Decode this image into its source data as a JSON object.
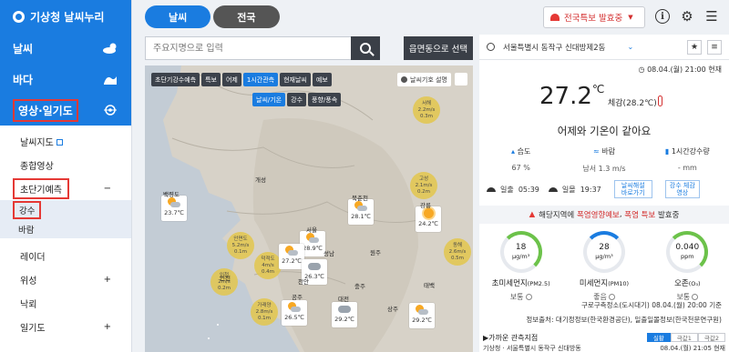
{
  "app": {
    "title": "기상청 날씨누리"
  },
  "sidebar": {
    "categories": [
      {
        "label": "날씨"
      },
      {
        "label": "바다"
      },
      {
        "label": "영상·일기도"
      }
    ],
    "sub_items": [
      {
        "label": "날씨지도"
      },
      {
        "label": "종합영상"
      },
      {
        "label": "초단기예측",
        "toggle": "−"
      },
      {
        "label": "레이더"
      },
      {
        "label": "위성",
        "toggle": "+"
      },
      {
        "label": "낙뢰"
      },
      {
        "label": "일기도",
        "toggle": "+"
      }
    ],
    "sub_sub_items": [
      {
        "label": "강수"
      },
      {
        "label": "바람"
      }
    ]
  },
  "tabs": [
    {
      "label": "날씨"
    },
    {
      "label": "전국"
    }
  ],
  "alert_button": {
    "label": "전국특보 발효중"
  },
  "search": {
    "placeholder": "주요지명으로 입력"
  },
  "emd_button": {
    "label": "읍면동으로 선택"
  },
  "map": {
    "toolbar": [
      "초단기강수예측",
      "특보",
      "어제",
      "1시간관측",
      "현재날씨",
      "예보"
    ],
    "toolbar_selected": "1시간관측",
    "toolbar2": [
      "날씨/기온",
      "강수",
      "풍향/풍속"
    ],
    "legend_label": "날씨기호 설명",
    "stations": [
      {
        "name": "백령도",
        "temp": "23.7℃"
      },
      {
        "name": "서울",
        "temp": "28.9℃"
      },
      {
        "name": "수원",
        "temp": "27.2℃"
      },
      {
        "name": "청주",
        "temp": "26.3℃"
      },
      {
        "name": "홍성",
        "temp": "26.5℃"
      },
      {
        "name": "대전",
        "temp": "29.2℃"
      },
      {
        "name": "북춘천",
        "temp": "28.1℃"
      },
      {
        "name": "강릉",
        "temp": "24.2℃"
      },
      {
        "name": "안동",
        "temp": "29.2℃"
      }
    ],
    "bubbles": [
      {
        "name": "안면도",
        "l1": "5.2m/s",
        "l2": "0.1m"
      },
      {
        "name": "덕적도",
        "l1": "4m/s",
        "l2": "0.4m"
      },
      {
        "name": "인천",
        "l1": "2m/s",
        "l2": "0.2m"
      },
      {
        "name": "고성",
        "l1": "2.1m/s",
        "l2": "0.2m"
      },
      {
        "name": "동해",
        "l1": "2.6m/s",
        "l2": "0.5m"
      },
      {
        "name": "서해",
        "l1": "2.2m/s",
        "l2": "0.3m"
      },
      {
        "name": "가래양",
        "l1": "2.8m/s",
        "l2": "0.1m"
      }
    ],
    "cities": [
      "개성",
      "인천",
      "성남",
      "원주",
      "충주",
      "대전",
      "공주",
      "천안",
      "태백",
      "상주"
    ]
  },
  "weather": {
    "location": "서울특별시 동작구 신대방제2동",
    "timestamp": "08.04.(월) 21:00 현재",
    "temperature": "27.2",
    "unit": "℃",
    "feels_like": "체감(28.2℃)",
    "summary": "어제와 기온이 같아요",
    "stats": [
      {
        "label": "습도",
        "value": "67 %"
      },
      {
        "label": "바람",
        "value": "남서 1.3 m/s"
      },
      {
        "label": "1시간강수량",
        "value": "- mm"
      }
    ],
    "sunrise_label": "일출",
    "sunrise": "05:39",
    "sunset_label": "일몰",
    "sunset": "19:37",
    "btn1": "날씨해설 바로가기",
    "btn2": "강수 체감영상",
    "warn": {
      "prefix": "해당지역에",
      "hot": "폭염영향예보",
      "mid": ",",
      "hot2": "폭염 특보",
      "suffix": "발효중"
    },
    "air": [
      {
        "value": "18",
        "unit": "μg/m³",
        "name": "초미세먼지",
        "sub": "(PM2.5)",
        "status": "보통",
        "color": "#6cc24a"
      },
      {
        "value": "28",
        "unit": "μg/m³",
        "name": "미세먼지",
        "sub": "(PM10)",
        "status": "좋음",
        "color": "#1a7ce0"
      },
      {
        "value": "0.040",
        "unit": "ppm",
        "name": "오존",
        "sub": "(O₃)",
        "status": "보통",
        "color": "#6cc24a"
      }
    ],
    "foot1": "구로구측정소(도시대기) 08.04.(월) 20:00 기준",
    "foot2": "정보출처: 대기정정보(한국환경공단), 일출일몰정보(한국천문연구원)",
    "near_title": "▶가까운 관측지점",
    "near_tabs": [
      "실황",
      "극값1",
      "극값2"
    ],
    "near_sub_left": "기상청 · 서울특별시 동작구 신대방동",
    "near_sub_right": "08.04.(월) 21:05 현재"
  }
}
